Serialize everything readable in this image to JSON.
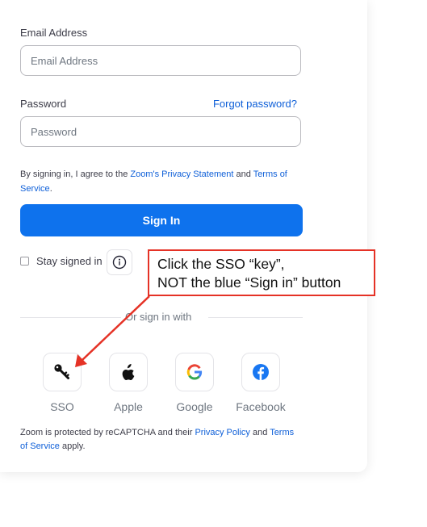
{
  "form": {
    "email_label": "Email Address",
    "email_placeholder": "Email Address",
    "password_label": "Password",
    "password_placeholder": "Password",
    "forgot_password": "Forgot password?"
  },
  "consent": {
    "prefix": "By signing in, I agree to the ",
    "privacy_link": "Zoom's Privacy Statement",
    "and": " and ",
    "terms_link": "Terms of Service",
    "suffix": "."
  },
  "signin_button": "Sign In",
  "stay_signed_in": "Stay signed in",
  "divider_text": "Or sign in with",
  "providers": [
    {
      "label": "SSO",
      "icon": "key-icon"
    },
    {
      "label": "Apple",
      "icon": "apple-icon"
    },
    {
      "label": "Google",
      "icon": "google-icon"
    },
    {
      "label": "Facebook",
      "icon": "facebook-icon"
    }
  ],
  "captcha": {
    "prefix": "Zoom is protected by reCAPTCHA and their ",
    "privacy_link": "Privacy Policy",
    "and": " and ",
    "terms_link": "Terms of Service",
    "suffix": " apply."
  },
  "callout": {
    "line1": "Click the SSO “key”,",
    "line2": "NOT the blue “Sign in” button"
  },
  "colors": {
    "primary": "#0e72ed",
    "link": "#0e5fd8",
    "callout_border": "#e53226"
  }
}
